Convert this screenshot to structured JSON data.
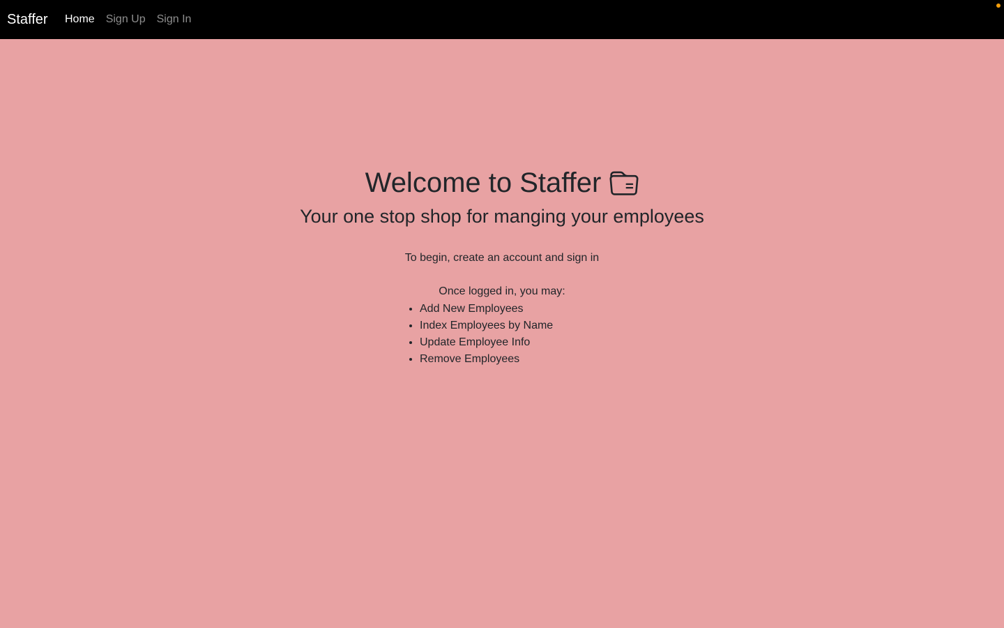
{
  "navbar": {
    "brand": "Staffer",
    "links": [
      {
        "label": "Home",
        "active": true
      },
      {
        "label": "Sign Up",
        "active": false
      },
      {
        "label": "Sign In",
        "active": false
      }
    ]
  },
  "hero": {
    "title": "Welcome to Staffer",
    "title_icon": "folder-icon",
    "subtitle": "Your one stop shop for manging your employees"
  },
  "intro": "To begin, create an account and sign in",
  "features": {
    "label": "Once logged in, you may:",
    "items": [
      "Add New Employees",
      "Index Employees by Name",
      "Update Employee Info",
      "Remove Employees"
    ]
  },
  "colors": {
    "background": "#e8a2a3",
    "navbar": "#000000",
    "text": "#212529",
    "status_dot": "#f59e0b"
  }
}
